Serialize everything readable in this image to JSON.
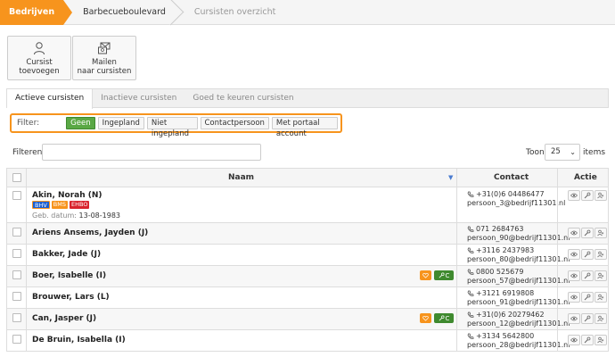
{
  "breadcrumb": [
    "Bedrijven",
    "Barbecueboulevard",
    "Cursisten overzicht"
  ],
  "actions": [
    {
      "label_1": "Cursist",
      "label_2": "toevoegen",
      "icon": "user-icon"
    },
    {
      "label_1": "Mailen",
      "label_2": "naar cursisten",
      "icon": "mail-group-icon"
    }
  ],
  "tabs": [
    "Actieve cursisten",
    "Inactieve cursisten",
    "Goed te keuren cursisten"
  ],
  "filter": {
    "label": "Filter:",
    "options": [
      "Geen",
      "Ingepland",
      "Niet ingepland",
      "Contactpersoon",
      "Met portaal account"
    ],
    "selected": "Geen"
  },
  "search": {
    "label": "Filteren",
    "value": ""
  },
  "pagesize": {
    "label": "Toon",
    "value": "25",
    "suffix": "items"
  },
  "columns": {
    "name": "Naam",
    "contact": "Contact",
    "actions": "Actie"
  },
  "colors": {
    "accent": "#f7941d",
    "green": "#5aa845",
    "bhv": "#1a5fd0",
    "bhv_border": "#f7941d",
    "ehbo": "#d9232d"
  },
  "rows": [
    {
      "name": "Akin, Norah (N)",
      "phone": "+31(0)6 04486477",
      "email": "persoon_3@bedrijf11301.nl",
      "badges": [
        {
          "text": "BHV",
          "color": "#1a5fd0"
        },
        {
          "text": "BMS",
          "color": "#f7941d"
        },
        {
          "text": "EHBO",
          "color": "#d9232d"
        }
      ],
      "dob_label": "Geb. datum:",
      "dob": "13-08-1983"
    },
    {
      "name": "Ariens Ansems, Jayden (J)",
      "phone": "071 2684763",
      "email": "persoon_90@bedrijf11301.nl"
    },
    {
      "name": "Bakker, Jade (J)",
      "phone": "+3116 2437983",
      "email": "persoon_80@bedrijf11301.nl"
    },
    {
      "name": "Boer, Isabelle (I)",
      "phone": "0800 525679",
      "email": "persoon_57@bedrijf11301.nl",
      "markers": {
        "contact": true,
        "portal": "C"
      }
    },
    {
      "name": "Brouwer, Lars (L)",
      "phone": "+3121 6919808",
      "email": "persoon_91@bedrijf11301.nl"
    },
    {
      "name": "Can, Jasper (J)",
      "phone": "+31(0)6 20279462",
      "email": "persoon_12@bedrijf11301.nl",
      "markers": {
        "contact": true,
        "portal": "C"
      }
    },
    {
      "name": "De Bruin, Isabella (I)",
      "phone": "+3134 5642800",
      "email": "persoon_28@bedrijf11301.nl"
    }
  ]
}
